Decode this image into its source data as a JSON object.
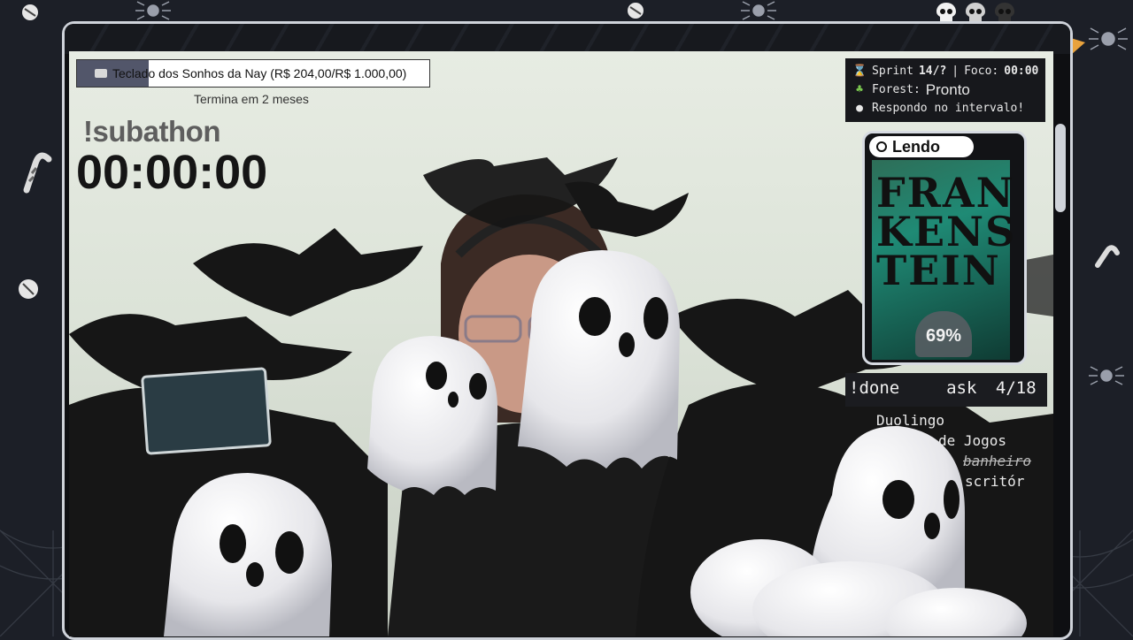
{
  "goal": {
    "label": "Teclado dos Sonhos da Nay (R$ 204,00/R$ 1.000,00)",
    "progress": 0.204,
    "ends": "Termina em 2 meses"
  },
  "subathon": {
    "command": "!subathon",
    "timer": "00:00:00"
  },
  "pomodoro": {
    "sprint_label": "Sprint",
    "sprint_value": "14/?",
    "focus_label": "Foco:",
    "focus_value": "00:00",
    "forest_label": "Forest:",
    "forest_value": "Pronto",
    "reply_text": "Respondo no intervalo!",
    "icons": [
      "hourglass-icon",
      "sprout-icon",
      "speech-bubble-icon"
    ]
  },
  "book": {
    "status": "Lendo",
    "title_lines": [
      "FRAN",
      "KENS",
      "TEIN"
    ],
    "progress": "69%"
  },
  "tasks": {
    "command": "!done",
    "label": "ask",
    "count": "4/18",
    "items": [
      {
        "text": "Duolingo",
        "done": false
      },
      {
        "text": "de Jogos",
        "done": false
      },
      {
        "text": "banheiro",
        "done": true
      },
      {
        "text": "scritór",
        "done": false
      }
    ]
  },
  "frame": {
    "skulls": 3,
    "accent": "#cfd3da",
    "background": "#1c1f27"
  }
}
